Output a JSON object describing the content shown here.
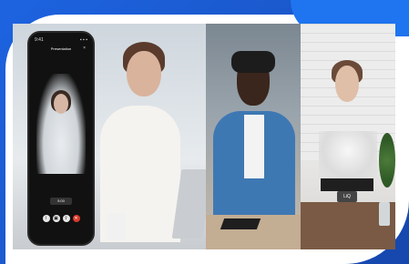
{
  "phone": {
    "status_time": "9:41",
    "status_icons": "▪ ▪ ▪",
    "title": "Presentation",
    "close_glyph": "×",
    "duration": "5:00",
    "controls": [
      {
        "name": "info-icon",
        "glyph": "i"
      },
      {
        "name": "camera-icon",
        "glyph": "▣"
      },
      {
        "name": "share-icon",
        "glyph": "⇪"
      },
      {
        "name": "end-call-icon",
        "glyph": "✕"
      }
    ]
  },
  "stand_label": "LiQ",
  "colors": {
    "background_blue": "#1b5fd8",
    "swoosh_blue": "#1f74f0",
    "end_call_red": "#d93a2b"
  }
}
